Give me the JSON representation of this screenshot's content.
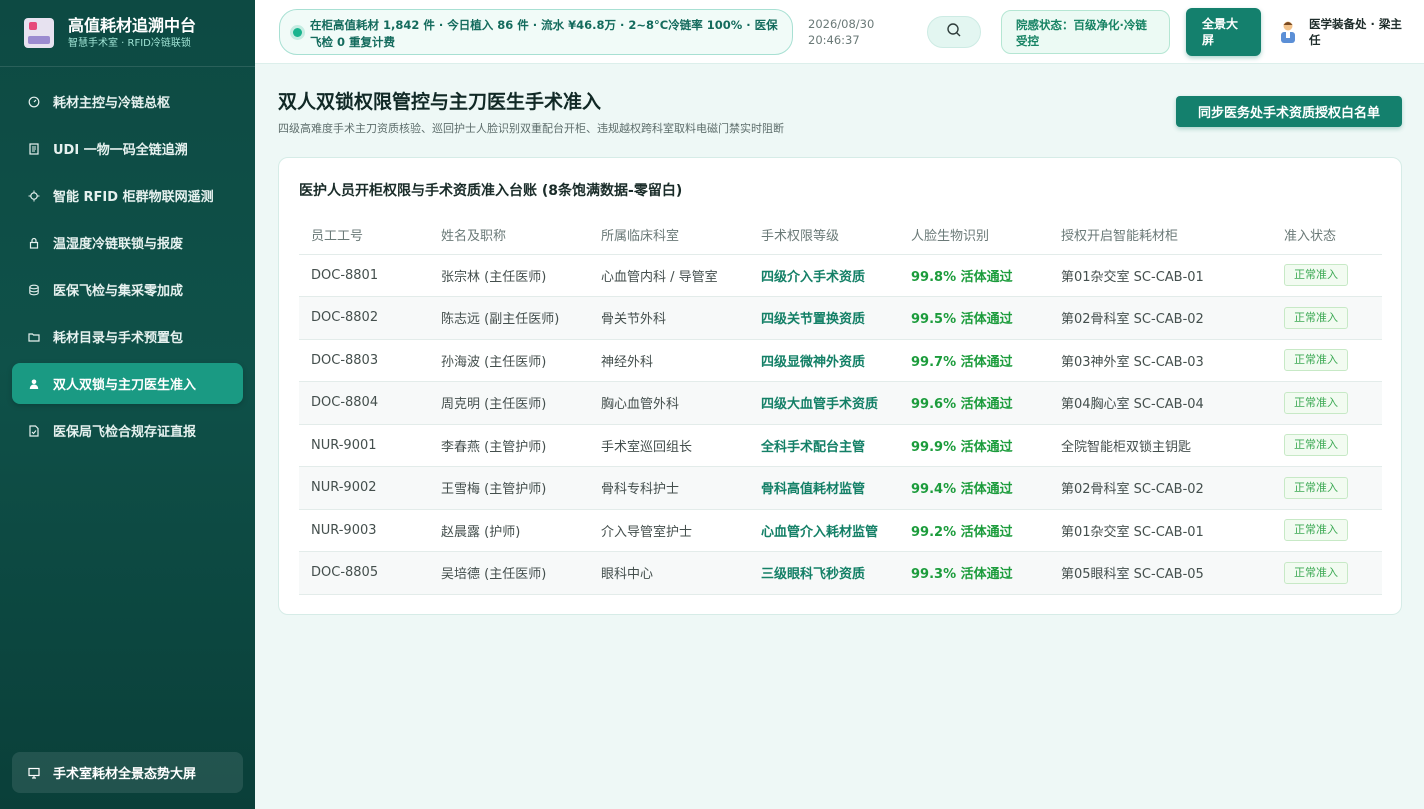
{
  "sidebar": {
    "brand_title": "高值耗材追溯中台",
    "brand_sub": "智慧手术室 · RFID冷链联锁",
    "items": [
      {
        "label": "耗材主控与冷链总枢",
        "icon": "gauge-icon"
      },
      {
        "label": "UDI 一物一码全链追溯",
        "icon": "barcode-doc-icon"
      },
      {
        "label": "智能 RFID 柜群物联网遥测",
        "icon": "chip-icon"
      },
      {
        "label": "温湿度冷链联锁与报废",
        "icon": "lock-icon"
      },
      {
        "label": "医保飞检与集采零加成",
        "icon": "database-icon"
      },
      {
        "label": "耗材目录与手术预置包",
        "icon": "folder-icon"
      },
      {
        "label": "双人双锁与主刀医生准入",
        "icon": "user-icon",
        "active": true
      },
      {
        "label": "医保局飞检合规存证直报",
        "icon": "file-check-icon"
      }
    ],
    "bottom_button": "手术室耗材全景态势大屏"
  },
  "topbar": {
    "ticker": "在柜高值耗材 1,842 件 · 今日植入 86 件 · 流水 ¥46.8万 · 2~8°C冷链率 100% · 医保飞检 0 重复计费",
    "date": "2026/08/30",
    "time": "20:46:37",
    "status": "院感状态：百级净化·冷链受控",
    "fullscreen": "全景大屏",
    "user": "医学装备处 · 梁主任"
  },
  "page": {
    "title": "双人双锁权限管控与主刀医生手术准入",
    "subtitle": "四级高难度手术主刀资质核验、巡回护士人脸识别双重配台开柜、违规越权跨科室取料电磁门禁实时阻断",
    "sync_button": "同步医务处手术资质授权白名单"
  },
  "table": {
    "title": "医护人员开柜权限与手术资质准入台账 (8条饱满数据-零留白)",
    "columns": [
      "员工工号",
      "姓名及职称",
      "所属临床科室",
      "手术权限等级",
      "人脸生物识别",
      "授权开启智能耗材柜",
      "准入状态"
    ],
    "rows": [
      {
        "id": "DOC-8801",
        "name": "张宗林 (主任医师)",
        "dept": "心血管内科 / 导管室",
        "level": "四级介入手术资质",
        "face": "99.8% 活体通过",
        "cabinet": "第01杂交室 SC-CAB-01",
        "status": "正常准入"
      },
      {
        "id": "DOC-8802",
        "name": "陈志远 (副主任医师)",
        "dept": "骨关节外科",
        "level": "四级关节置换资质",
        "face": "99.5% 活体通过",
        "cabinet": "第02骨科室 SC-CAB-02",
        "status": "正常准入"
      },
      {
        "id": "DOC-8803",
        "name": "孙海波 (主任医师)",
        "dept": "神经外科",
        "level": "四级显微神外资质",
        "face": "99.7% 活体通过",
        "cabinet": "第03神外室 SC-CAB-03",
        "status": "正常准入"
      },
      {
        "id": "DOC-8804",
        "name": "周克明 (主任医师)",
        "dept": "胸心血管外科",
        "level": "四级大血管手术资质",
        "face": "99.6% 活体通过",
        "cabinet": "第04胸心室 SC-CAB-04",
        "status": "正常准入"
      },
      {
        "id": "NUR-9001",
        "name": "李春燕 (主管护师)",
        "dept": "手术室巡回组长",
        "level": "全科手术配台主管",
        "face": "99.9% 活体通过",
        "cabinet": "全院智能柜双锁主钥匙",
        "status": "正常准入"
      },
      {
        "id": "NUR-9002",
        "name": "王雪梅 (主管护师)",
        "dept": "骨科专科护士",
        "level": "骨科高值耗材监管",
        "face": "99.4% 活体通过",
        "cabinet": "第02骨科室 SC-CAB-02",
        "status": "正常准入"
      },
      {
        "id": "NUR-9003",
        "name": "赵晨露 (护师)",
        "dept": "介入导管室护士",
        "level": "心血管介入耗材监管",
        "face": "99.2% 活体通过",
        "cabinet": "第01杂交室 SC-CAB-01",
        "status": "正常准入"
      },
      {
        "id": "DOC-8805",
        "name": "吴培德 (主任医师)",
        "dept": "眼科中心",
        "level": "三级眼科飞秒资质",
        "face": "99.3% 活体通过",
        "cabinet": "第05眼科室 SC-CAB-05",
        "status": "正常准入"
      }
    ]
  }
}
